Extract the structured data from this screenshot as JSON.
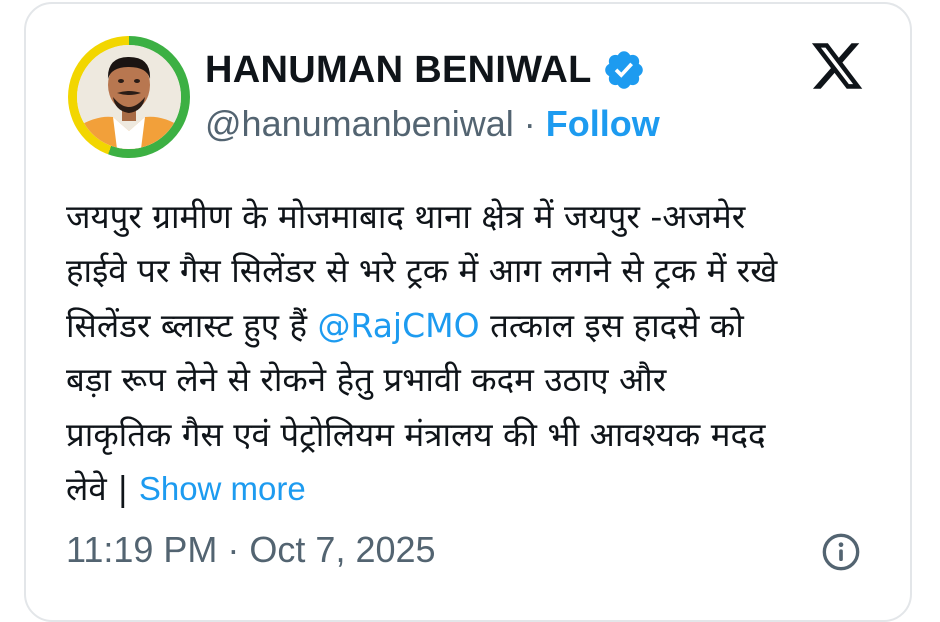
{
  "author": {
    "name": "HANUMAN BENIWAL",
    "handle": "@hanumanbeniwal",
    "separator": "·",
    "follow_label": "Follow",
    "verified": true,
    "avatar_ring_colors": [
      "#3cb043",
      "#f2d600"
    ]
  },
  "tweet": {
    "lines": [
      "जयपुर ग्रामीण के मोजमाबाद थाना क्षेत्र में जयपुर -अजमेर",
      "हाईवे पर गैस सिलेंडर से भरे ट्रक में आग लगने से ट्रक में रखे",
      "सिलेंडर ब्लास्ट हुए हैं ",
      "बड़ा रूप लेने से रोकने हेतु प्रभावी कदम उठाए और",
      "प्राकृतिक गैस एवं पेट्रोलियम मंत्रालय की भी आवश्यक मदद",
      "लेवे | "
    ],
    "mention": "@RajCMO",
    "after_mention": " तत्काल इस हादसे को",
    "show_more_label": "Show more"
  },
  "footer": {
    "time": "11:19 PM",
    "separator": "·",
    "date": "Oct 7, 2025"
  },
  "icons": {
    "brand": "x-logo-icon",
    "verified": "verified-badge-icon",
    "info": "info-icon"
  },
  "colors": {
    "link": "#1d9bf0",
    "text": "#0f1419",
    "secondary": "#536471",
    "border": "#e3e6e9"
  }
}
